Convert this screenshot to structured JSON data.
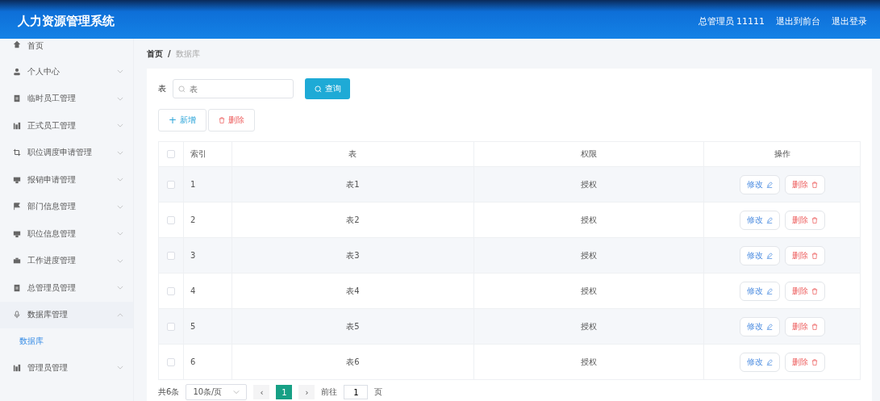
{
  "header": {
    "title": "人力资源管理系统",
    "user": "总管理员 11111",
    "links": [
      "退出到前台",
      "退出登录"
    ]
  },
  "sidebar": {
    "items": [
      {
        "label": "首页",
        "kind": "home"
      },
      {
        "label": "个人中心",
        "kind": "user",
        "expandable": true,
        "expanded": false
      },
      {
        "label": "临时员工管理",
        "kind": "doc",
        "expandable": true,
        "expanded": false
      },
      {
        "label": "正式员工管理",
        "kind": "chart",
        "expandable": true,
        "expanded": false
      },
      {
        "label": "职位调度申请管理",
        "kind": "crop",
        "expandable": true,
        "expanded": false
      },
      {
        "label": "报销申请管理",
        "kind": "chat",
        "expandable": true,
        "expanded": false
      },
      {
        "label": "部门信息管理",
        "kind": "flag",
        "expandable": true,
        "expanded": false
      },
      {
        "label": "职位信息管理",
        "kind": "chat",
        "expandable": true,
        "expanded": false
      },
      {
        "label": "工作进度管理",
        "kind": "case",
        "expandable": true,
        "expanded": false
      },
      {
        "label": "总管理员管理",
        "kind": "doc",
        "expandable": true,
        "expanded": false
      },
      {
        "label": "数据库管理",
        "kind": "mic",
        "expandable": true,
        "expanded": true,
        "children": [
          {
            "label": "数据库",
            "selected": true
          }
        ]
      },
      {
        "label": "管理员管理",
        "kind": "chart",
        "expandable": true,
        "expanded": false
      }
    ]
  },
  "breadcrumb": {
    "items": [
      "首页",
      "数据库"
    ],
    "separator": "/"
  },
  "search": {
    "label": "表",
    "placeholder": "表",
    "button": "查询"
  },
  "actions": {
    "add_symbol": "+",
    "add": "新增",
    "delete": "删除"
  },
  "table": {
    "all_checked": false,
    "columns": [
      "索引",
      "表",
      "权限",
      "操作"
    ],
    "rows": [
      {
        "index": "1",
        "table": "表1",
        "permission": "授权",
        "checked": false,
        "edit": "修改",
        "delete": "删除"
      },
      {
        "index": "2",
        "table": "表2",
        "permission": "授权",
        "checked": false,
        "edit": "修改",
        "delete": "删除"
      },
      {
        "index": "3",
        "table": "表3",
        "permission": "授权",
        "checked": false,
        "edit": "修改",
        "delete": "删除"
      },
      {
        "index": "4",
        "table": "表4",
        "permission": "授权",
        "checked": false,
        "edit": "修改",
        "delete": "删除"
      },
      {
        "index": "5",
        "table": "表5",
        "permission": "授权",
        "checked": false,
        "edit": "修改",
        "delete": "删除"
      },
      {
        "index": "6",
        "table": "表6",
        "permission": "授权",
        "checked": false,
        "edit": "修改",
        "delete": "删除"
      }
    ]
  },
  "pagination": {
    "total": "共6条",
    "page_size": "10条/页",
    "prev": "‹",
    "pages": [
      {
        "label": "1",
        "selected": true
      }
    ],
    "next": "›",
    "goto": "前往",
    "goto_value": "1",
    "page_unit": "页"
  }
}
